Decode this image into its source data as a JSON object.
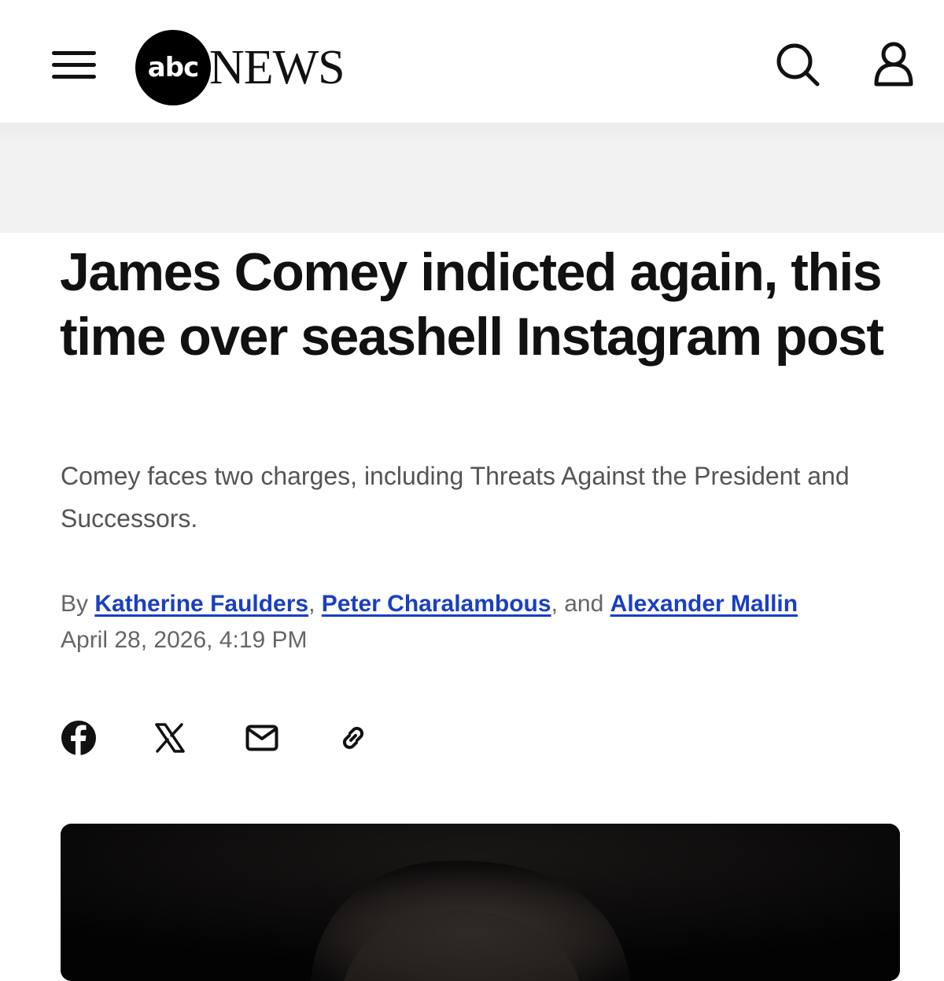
{
  "header": {
    "logo_abc": "abc",
    "logo_news": "NEWS",
    "icons": [
      "hamburger-menu-icon",
      "search-icon",
      "user-icon"
    ]
  },
  "article": {
    "title": "James Comey indicted again, this time over seashell Instagram post",
    "subtitle": "Comey faces two charges, including Threats Against the President and Successors.",
    "byline": {
      "prefix": "By",
      "authors": [
        "Katherine Faulders",
        "Peter Charalambous",
        "Alexander Mallin"
      ],
      "sep1": ",",
      "sep2": ", and"
    },
    "date": "April 28, 2026, 4:19 PM",
    "share_icons": [
      "facebook-icon",
      "x-icon",
      "email-icon",
      "link-icon"
    ]
  },
  "colors": {
    "link": "#1a3fc4",
    "text": "#111111",
    "muted": "#666666",
    "ad_band": "#f2f2f2"
  }
}
